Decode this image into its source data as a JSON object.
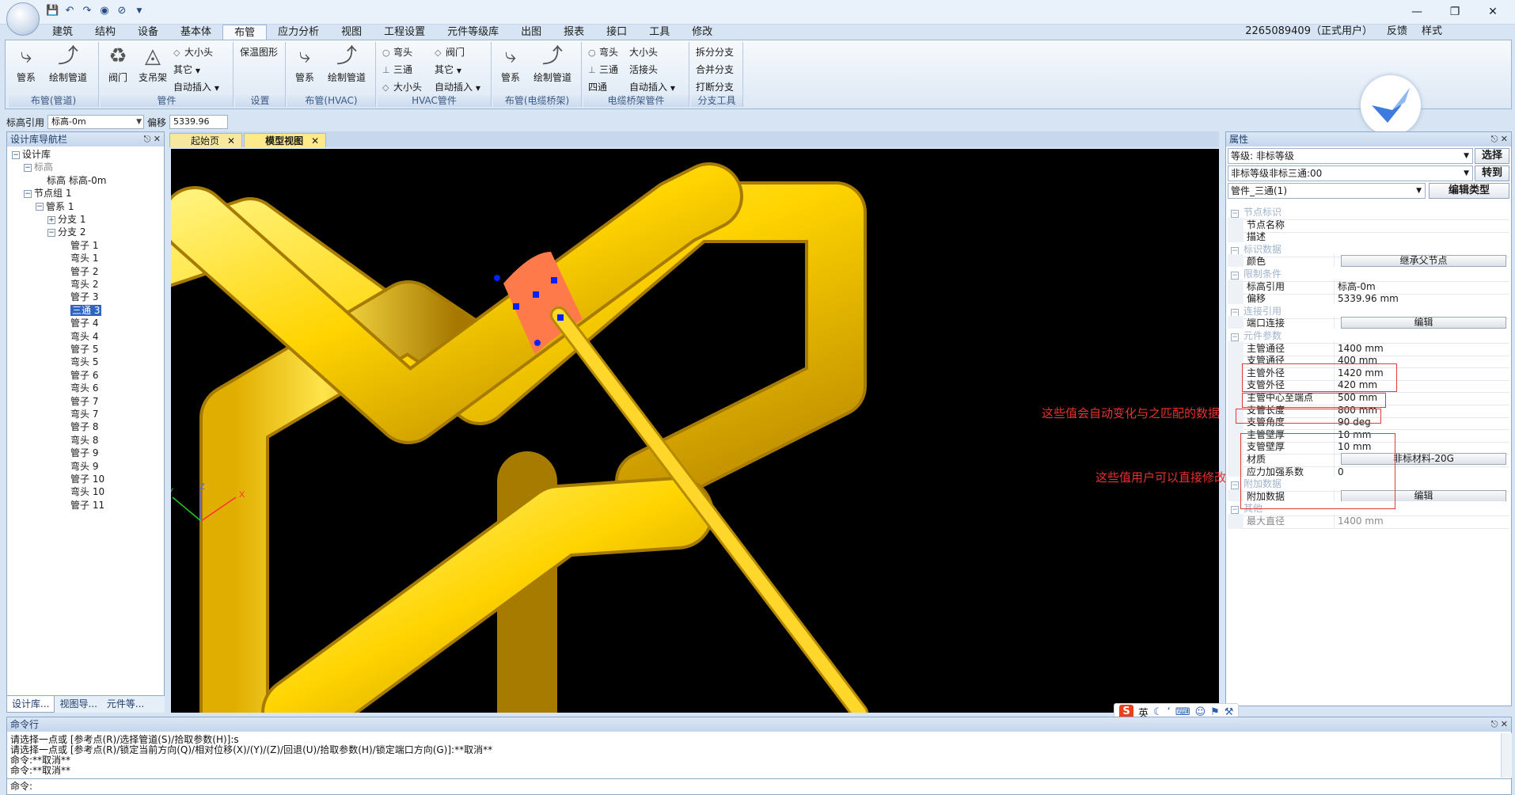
{
  "titlebar": {
    "qat": [
      "save-icon",
      "undo-icon",
      "redo-icon",
      "eye-icon",
      "eye-off-icon"
    ],
    "user": "2265089409（正式用户）",
    "feedback": "反馈",
    "style": "样式"
  },
  "ribbon": {
    "tabs": [
      "建筑",
      "结构",
      "设备",
      "基本体",
      "布管",
      "应力分析",
      "视图",
      "工程设置",
      "元件等级库",
      "出图",
      "报表",
      "接口",
      "工具",
      "修改"
    ],
    "active_tab": "布管",
    "groups": {
      "pipe_layout": {
        "label": "布管(管道)",
        "pipe_system": "管系",
        "draw_pipe": "绘制管道"
      },
      "fittings": {
        "label": "管件",
        "valve": "阀门",
        "support": "支吊架",
        "reducer": "大小头",
        "other": "其它",
        "auto_insert": "自动插入"
      },
      "settings": {
        "label": "设置",
        "insulation": "保温图形"
      },
      "hvac_layout": {
        "label": "布管(HVAC)",
        "pipe_system": "管系",
        "draw_pipe": "绘制管道"
      },
      "hvac_fittings": {
        "label": "HVAC管件",
        "elbow": "弯头",
        "valve": "阀门",
        "tee": "三通",
        "other": "其它",
        "reducer": "大小头",
        "auto_insert": "自动插入"
      },
      "cable_layout": {
        "label": "布管(电缆桥架)",
        "pipe_system": "管系",
        "draw_pipe": "绘制管道"
      },
      "cable_fittings": {
        "label": "电缆桥架管件",
        "elbow": "弯头",
        "reducer": "大小头",
        "tee": "三通",
        "union": "活接头",
        "cross": "四通",
        "auto_insert": "自动插入"
      },
      "branch_tools": {
        "label": "分支工具",
        "split": "拆分分支",
        "merge": "合并分支",
        "break": "打断分支"
      }
    }
  },
  "refbar": {
    "label": "标高引用",
    "value": "标高-0m",
    "offset_label": "偏移",
    "offset_value": "5339.96 mm"
  },
  "navigator": {
    "title": "设计库导航栏",
    "nodes": [
      {
        "label": "设计库",
        "lvl": 0,
        "tg": "−"
      },
      {
        "label": "标高",
        "lvl": 1,
        "tg": "−",
        "muted": true
      },
      {
        "label": "标高 标高-0m",
        "lvl": 2
      },
      {
        "label": "节点组 1",
        "lvl": 1,
        "tg": "−"
      },
      {
        "label": "管系 1",
        "lvl": 2,
        "tg": "−"
      },
      {
        "label": "分支 1",
        "lvl": 3,
        "tg": "+"
      },
      {
        "label": "分支 2",
        "lvl": 3,
        "tg": "−"
      },
      {
        "label": "管子 1",
        "lvl": 4
      },
      {
        "label": "弯头 1",
        "lvl": 4
      },
      {
        "label": "管子 2",
        "lvl": 4
      },
      {
        "label": "弯头 2",
        "lvl": 4
      },
      {
        "label": "管子 3",
        "lvl": 4
      },
      {
        "label": "三通 3",
        "lvl": 4,
        "sel": true
      },
      {
        "label": "管子 4",
        "lvl": 4
      },
      {
        "label": "弯头 4",
        "lvl": 4
      },
      {
        "label": "管子 5",
        "lvl": 4
      },
      {
        "label": "弯头 5",
        "lvl": 4
      },
      {
        "label": "管子 6",
        "lvl": 4
      },
      {
        "label": "弯头 6",
        "lvl": 4
      },
      {
        "label": "管子 7",
        "lvl": 4
      },
      {
        "label": "弯头 7",
        "lvl": 4
      },
      {
        "label": "管子 8",
        "lvl": 4
      },
      {
        "label": "弯头 8",
        "lvl": 4
      },
      {
        "label": "管子 9",
        "lvl": 4
      },
      {
        "label": "弯头 9",
        "lvl": 4
      },
      {
        "label": "管子 10",
        "lvl": 4
      },
      {
        "label": "弯头 10",
        "lvl": 4
      },
      {
        "label": "管子 11",
        "lvl": 4
      }
    ],
    "tabs": [
      "设计库...",
      "视图导...",
      "元件等..."
    ]
  },
  "doc_tabs": [
    {
      "label": "起始页",
      "active": false
    },
    {
      "label": "模型视图",
      "active": true
    }
  ],
  "viewport": {
    "axes": {
      "x": "X",
      "y": "Y",
      "z": "Z"
    }
  },
  "properties": {
    "title": "属性",
    "grade": "等级: 非标等级",
    "select_btn": "选择",
    "subgrade": "非标等级非标三通:00",
    "goto_btn": "转到",
    "type": "管件_三通(1)",
    "edit_type_btn": "编辑类型",
    "rows": [
      {
        "cat": true,
        "k": "节点标识"
      },
      {
        "k": "节点名称",
        "v": ""
      },
      {
        "k": "描述",
        "v": ""
      },
      {
        "cat": true,
        "k": "标识数据"
      },
      {
        "k": "颜色",
        "v": "继承父节点",
        "btn": true
      },
      {
        "cat": true,
        "k": "限制条件"
      },
      {
        "k": "标高引用",
        "v": "标高-0m"
      },
      {
        "k": "偏移",
        "v": "5339.96 mm"
      },
      {
        "cat": true,
        "k": "连接引用"
      },
      {
        "k": "端口连接",
        "v": "编辑",
        "btn": true
      },
      {
        "cat": true,
        "k": "元件参数"
      },
      {
        "k": "主管通径",
        "v": "1400 mm"
      },
      {
        "k": "支管通径",
        "v": "400 mm"
      },
      {
        "k": "主管外径",
        "v": "1420 mm"
      },
      {
        "k": "支管外径",
        "v": "420 mm"
      },
      {
        "k": "主管中心至端点",
        "v": "500 mm"
      },
      {
        "k": "支管长度",
        "v": "800 mm"
      },
      {
        "k": "支管角度",
        "v": "90 deg"
      },
      {
        "k": "主管壁厚",
        "v": "10 mm"
      },
      {
        "k": "支管壁厚",
        "v": "10 mm"
      },
      {
        "k": "材质",
        "v": "非标材料-20G",
        "btn": true
      },
      {
        "k": "应力加强系数",
        "v": "0"
      },
      {
        "cat": true,
        "k": "附加数据"
      },
      {
        "k": "附加数据",
        "v": "编辑",
        "btn": true
      },
      {
        "cat": true,
        "k": "其他"
      },
      {
        "k": "最大直径",
        "v": "1400 mm",
        "dis": true
      }
    ]
  },
  "annotations": {
    "auto": "这些值会自动变化与之匹配的数据",
    "editable": "这些值用户可以直接修改"
  },
  "command": {
    "title": "命令行",
    "lines": [
      "请选择一点或 [参考点(R)/选择管道(S)/拾取参数(H)]:s",
      "请选择一点或 [参考点(R)/锁定当前方向(Q)/相对位移(X)/(Y)/(Z)/回退(U)/拾取参数(H)/锁定端口方向(G)]:**取消**",
      "命令:**取消**",
      "命令:**取消**"
    ],
    "prompt": "命令:"
  },
  "ime": {
    "label": "英"
  }
}
